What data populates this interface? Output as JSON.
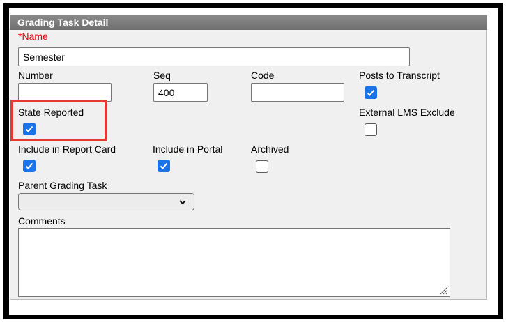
{
  "panel": {
    "title": "Grading Task Detail"
  },
  "fields": {
    "name": {
      "required_mark": "*",
      "label": "Name",
      "value": "Semester"
    },
    "number": {
      "label": "Number",
      "value": ""
    },
    "seq": {
      "label": "Seq",
      "value": "400"
    },
    "code": {
      "label": "Code",
      "value": ""
    },
    "posts_to_transcript": {
      "label": "Posts to Transcript",
      "checked": true
    },
    "state_reported": {
      "label": "State Reported",
      "checked": true
    },
    "external_lms_exclude": {
      "label": "External LMS Exclude",
      "checked": false
    },
    "include_in_report_card": {
      "label": "Include in Report Card",
      "checked": true
    },
    "include_in_portal": {
      "label": "Include in Portal",
      "checked": true
    },
    "archived": {
      "label": "Archived",
      "checked": false
    },
    "parent_grading_task": {
      "label": "Parent Grading Task",
      "selected": ""
    },
    "comments": {
      "label": "Comments",
      "value": ""
    }
  },
  "colors": {
    "checkbox_checked": "#1a73e8",
    "highlight": "#e53935",
    "required": "#e00000",
    "header": "#7a7a7a"
  },
  "icons": {
    "check": "check-icon",
    "dropdown": "chevron-down-icon",
    "resize": "resize-grip-icon"
  }
}
